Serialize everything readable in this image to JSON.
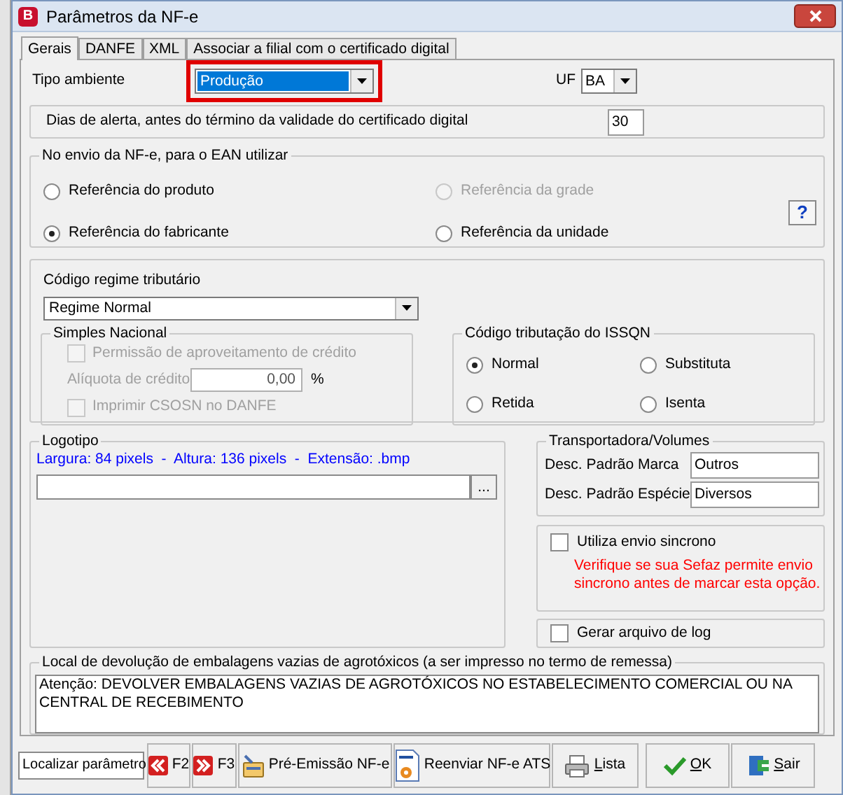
{
  "window": {
    "title": "Parâmetros da NF-e",
    "icon_letter": "B"
  },
  "tabs": [
    {
      "label": "Gerais",
      "selected": true
    },
    {
      "label": "DANFE",
      "selected": false
    },
    {
      "label": "XML",
      "selected": false
    },
    {
      "label": "Associar a filial com o certificado digital",
      "selected": false
    }
  ],
  "tipo_ambiente": {
    "label": "Tipo ambiente",
    "value": "Produção",
    "highlighted": true
  },
  "uf": {
    "label": "UF",
    "value": "BA"
  },
  "dias_alerta": {
    "label": "Dias de alerta, antes do término da validade do certificado digital",
    "value": "30"
  },
  "ean": {
    "title": "No envio da NF-e, para o EAN utilizar",
    "help": "?",
    "options": [
      {
        "label": "Referência do produto",
        "selected": false,
        "disabled": false
      },
      {
        "label": "Referência da grade",
        "selected": false,
        "disabled": true
      },
      {
        "label": "Referência do fabricante",
        "selected": true,
        "disabled": false
      },
      {
        "label": "Referência da unidade",
        "selected": false,
        "disabled": false
      }
    ]
  },
  "regime": {
    "label": "Código regime tributário",
    "value": "Regime Normal"
  },
  "simples_nacional": {
    "title": "Simples Nacional",
    "disabled": true,
    "permissao": {
      "label": "Permissão de aproveitamento de crédito",
      "checked": false
    },
    "aliquota": {
      "label": "Alíquota de crédito",
      "value": "0,00",
      "unit": "%"
    },
    "imprimir": {
      "label": "Imprimir CSOSN no DANFE",
      "checked": false
    }
  },
  "issqn": {
    "title": "Código tributação do ISSQN",
    "options": [
      {
        "label": "Normal",
        "selected": true
      },
      {
        "label": "Substituta",
        "selected": false
      },
      {
        "label": "Retida",
        "selected": false
      },
      {
        "label": "Isenta",
        "selected": false
      }
    ]
  },
  "logotipo": {
    "title": "Logotipo",
    "hint": "Largura: 84 pixels  -  Altura: 136 pixels  -  Extensão: .bmp",
    "browse": "..."
  },
  "transportadora": {
    "title": "Transportadora/Volumes",
    "fields": [
      {
        "label": "Desc. Padrão Marca",
        "value": "Outros"
      },
      {
        "label": "Desc. Padrão Espécie",
        "value": "Diversos"
      }
    ]
  },
  "envio_sincrono": {
    "label": "Utiliza envio sincrono",
    "checked": false,
    "warning": "Verifique se sua Sefaz permite envio sincrono antes de marcar esta opção."
  },
  "gerar_log": {
    "label": "Gerar arquivo de log",
    "checked": false
  },
  "devolucao": {
    "title": "Local de devolução de embalagens vazias de agrotóxicos (a ser impresso no termo de remessa)",
    "value": "Atenção: DEVOLVER EMBALAGENS VAZIAS DE AGROTÓXICOS NO ESTABELECIMENTO COMERCIAL OU NA CENTRAL DE RECEBIMENTO"
  },
  "toolbar": {
    "search": {
      "value": "Localizar parâmetro"
    },
    "buttons": [
      {
        "label": "F2",
        "kind": "prev",
        "underline_first": false
      },
      {
        "label": "F3",
        "kind": "next",
        "underline_first": false
      },
      {
        "label": "Pré-Emissão NF-e",
        "kind": "card",
        "underline_first": false
      },
      {
        "label": "Reenviar NF-e ATS",
        "kind": "document",
        "underline_first": false
      },
      {
        "label": "Lista",
        "kind": "printer",
        "underline_first": true
      },
      {
        "label": "OK",
        "kind": "check",
        "underline_first": true
      },
      {
        "label": "Sair",
        "kind": "door",
        "underline_first": true
      }
    ]
  }
}
